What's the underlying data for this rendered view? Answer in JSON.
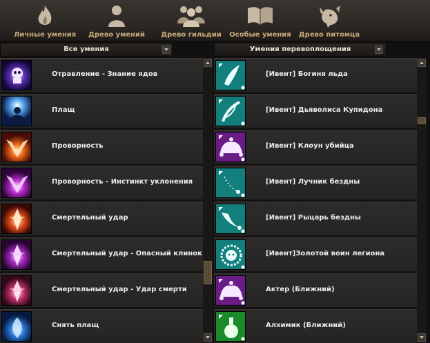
{
  "tabs": [
    {
      "label": "Личные умения",
      "icon": "flame-icon"
    },
    {
      "label": "Древо умений",
      "icon": "person-icon"
    },
    {
      "label": "Древо гильдии",
      "icon": "group-icon"
    },
    {
      "label": "Особые умения",
      "icon": "book-icon"
    },
    {
      "label": "Древо питомца",
      "icon": "pet-icon"
    }
  ],
  "left_panel": {
    "header": "Все умения",
    "items": [
      {
        "name": "Отравление - Знание ядов",
        "icon": "poison-skull-icon"
      },
      {
        "name": "Плащ",
        "icon": "cloak-icon"
      },
      {
        "name": "Проворность",
        "icon": "agility-icon"
      },
      {
        "name": "Проворность - Инстинкт уклонения",
        "icon": "evasion-icon"
      },
      {
        "name": "Смертельный удар",
        "icon": "deadly-strike-icon"
      },
      {
        "name": "Смертельный удар - Опасный клинок",
        "icon": "dangerous-blade-icon"
      },
      {
        "name": "Смертельный удар - Удар смерти",
        "icon": "death-strike-icon"
      },
      {
        "name": "Снять плащ",
        "icon": "remove-cloak-icon"
      }
    ]
  },
  "right_panel": {
    "header": "Умения перевоплощения",
    "items": [
      {
        "name": "[Ивент] Богиня льда",
        "icon": "ice-goddess-icon"
      },
      {
        "name": "[Ивент] Дьяволиса Купидона",
        "icon": "cupid-bow-icon"
      },
      {
        "name": "[Ивент] Клоун убийца",
        "icon": "jester-hat-icon"
      },
      {
        "name": "[Ивент] Лучник бездны",
        "icon": "abyss-archer-icon"
      },
      {
        "name": "[Ивент] Рыцарь бездны",
        "icon": "abyss-knight-icon"
      },
      {
        "name": "[Ивент]Золотой воин легиона",
        "icon": "lion-head-icon"
      },
      {
        "name": "Актер (Ближний)",
        "icon": "jester-hat-icon"
      },
      {
        "name": "Алхимик (Ближний)",
        "icon": "potion-flask-icon"
      }
    ]
  },
  "colors": {
    "tab_label": "#c7a97b",
    "row_bg": "#2a2826",
    "teal": "#1a8a86",
    "purple": "#6a1c86"
  }
}
